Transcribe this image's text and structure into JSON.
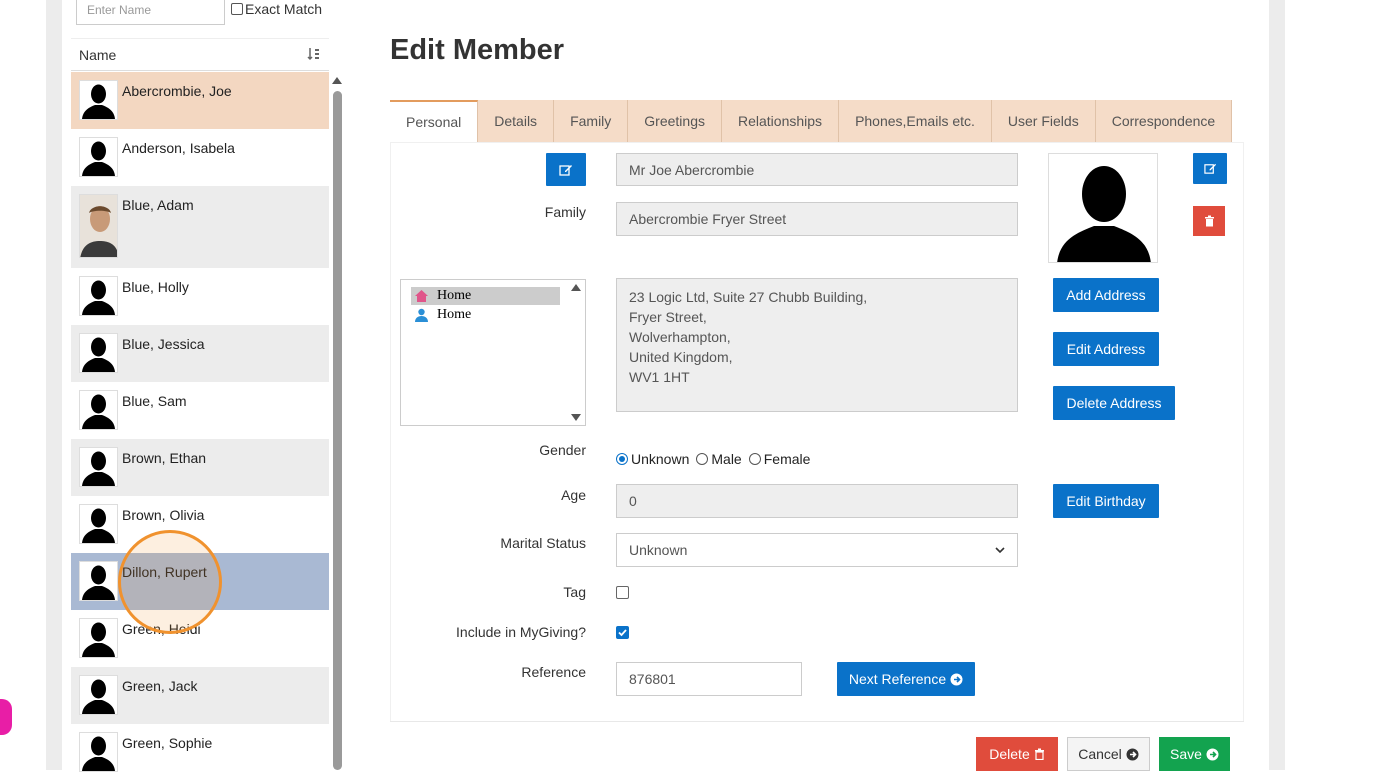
{
  "search": {
    "placeholder": "Enter Name",
    "exact_match_label": "Exact Match"
  },
  "list": {
    "header": "Name",
    "members": [
      {
        "name": "Abercrombie, Joe",
        "photo": "silhouette"
      },
      {
        "name": "Anderson, Isabela",
        "photo": "silhouette"
      },
      {
        "name": "Blue, Adam",
        "photo": "portrait"
      },
      {
        "name": "Blue, Holly",
        "photo": "silhouette"
      },
      {
        "name": "Blue, Jessica",
        "photo": "silhouette"
      },
      {
        "name": "Blue, Sam",
        "photo": "silhouette"
      },
      {
        "name": "Brown, Ethan",
        "photo": "silhouette"
      },
      {
        "name": "Brown, Olivia",
        "photo": "silhouette"
      },
      {
        "name": "Dillon, Rupert",
        "photo": "silhouette"
      },
      {
        "name": "Green, Heidi",
        "photo": "silhouette"
      },
      {
        "name": "Green, Jack",
        "photo": "silhouette"
      },
      {
        "name": "Green, Sophie",
        "photo": "silhouette"
      }
    ]
  },
  "page": {
    "title": "Edit Member"
  },
  "tabs": [
    "Personal",
    "Details",
    "Family",
    "Greetings",
    "Relationships",
    "Phones,Emails etc.",
    "User Fields",
    "Correspondence"
  ],
  "form": {
    "display_name": "Mr Joe Abercrombie",
    "family_label": "Family",
    "family_value": "Abercrombie Fryer Street",
    "addresses": [
      {
        "label": "Home",
        "icon": "house-icon"
      },
      {
        "label": "Home",
        "icon": "person-icon"
      }
    ],
    "address_lines": [
      "23 Logic Ltd, Suite 27 Chubb Building,",
      "Fryer Street,",
      "Wolverhampton,",
      "United Kingdom,",
      "WV1 1HT"
    ],
    "add_address": "Add Address",
    "edit_address": "Edit Address",
    "delete_address": "Delete Address",
    "gender_label": "Gender",
    "gender_options": [
      "Unknown",
      "Male",
      "Female"
    ],
    "gender_selected": "Unknown",
    "age_label": "Age",
    "age_value": "0",
    "edit_birthday": "Edit Birthday",
    "marital_label": "Marital Status",
    "marital_value": "Unknown",
    "tag_label": "Tag",
    "mygiving_label": "Include in MyGiving?",
    "reference_label": "Reference",
    "reference_value": "876801",
    "next_reference": "Next Reference"
  },
  "footer": {
    "delete": "Delete",
    "cancel": "Cancel",
    "save": "Save"
  },
  "colors": {
    "accent_blue": "#0a72c9",
    "danger": "#e04c3c",
    "success": "#13a34f",
    "tab_bg": "#f5dcc8",
    "selected_row": "#f3d7c1",
    "hover_row": "#a9b9d3",
    "highlight_circle": "#f0922e"
  }
}
